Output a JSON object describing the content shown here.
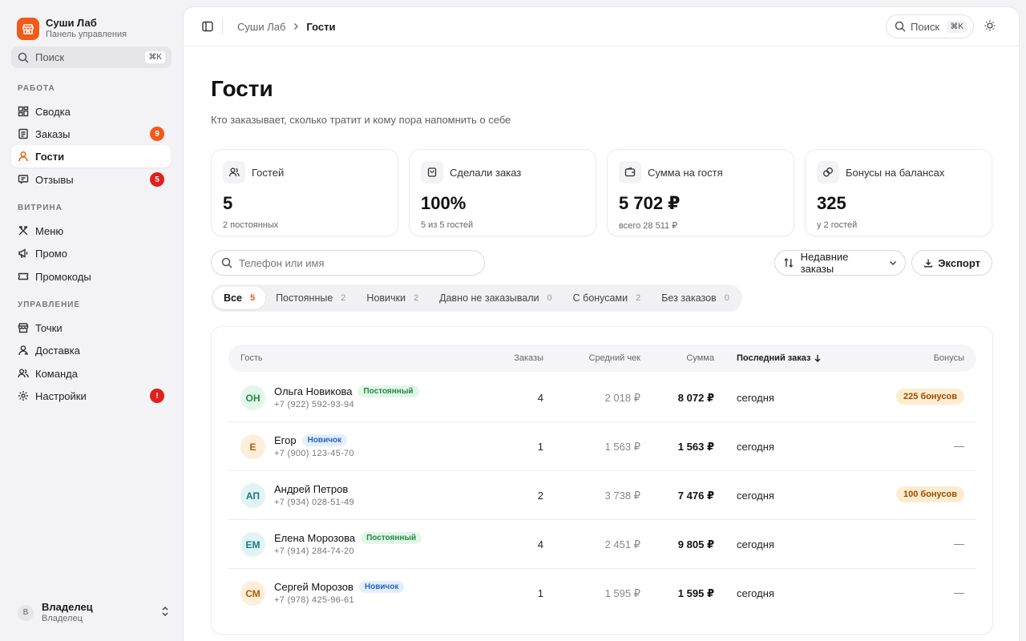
{
  "brand": {
    "title": "Суши Лаб",
    "subtitle": "Панель управления"
  },
  "sidebar_search": {
    "label": "Поиск",
    "shortcut": "⌘K"
  },
  "nav": {
    "sections": [
      {
        "title": "РАБОТА",
        "items": [
          {
            "label": "Сводка",
            "icon": "dashboard-icon"
          },
          {
            "label": "Заказы",
            "icon": "orders-icon",
            "badge": "9",
            "badge_color": "#f25a1a"
          },
          {
            "label": "Гости",
            "icon": "user-icon",
            "active": true
          },
          {
            "label": "Отзывы",
            "icon": "reviews-icon",
            "badge": "5",
            "badge_color": "#e0201a"
          }
        ]
      },
      {
        "title": "ВИТРИНА",
        "items": [
          {
            "label": "Меню",
            "icon": "utensils-icon"
          },
          {
            "label": "Промо",
            "icon": "megaphone-icon"
          },
          {
            "label": "Промокоды",
            "icon": "ticket-icon"
          }
        ]
      },
      {
        "title": "УПРАВЛЕНИЕ",
        "items": [
          {
            "label": "Точки",
            "icon": "store-icon"
          },
          {
            "label": "Доставка",
            "icon": "delivery-icon"
          },
          {
            "label": "Команда",
            "icon": "team-icon"
          },
          {
            "label": "Настройки",
            "icon": "gear-icon",
            "badge": "!",
            "badge_color": "#e0201a"
          }
        ]
      }
    ]
  },
  "user": {
    "initial": "В",
    "name": "Владелец",
    "role": "Владелец"
  },
  "breadcrumbs": {
    "root": "Суши Лаб",
    "current": "Гости"
  },
  "top_search": {
    "label": "Поиск",
    "shortcut": "⌘K"
  },
  "page": {
    "title": "Гости",
    "subtitle": "Кто заказывает, сколько тратит и кому пора напомнить о себе"
  },
  "stats": [
    {
      "label": "Гостей",
      "value": "5",
      "note": "2 постоянных",
      "icon": "users-icon"
    },
    {
      "label": "Сделали заказ",
      "value": "100%",
      "note": "5 из 5 гостей",
      "icon": "bag-icon"
    },
    {
      "label": "Сумма на гостя",
      "value": "5 702 ₽",
      "note": "всего 28 511 ₽",
      "icon": "wallet-icon"
    },
    {
      "label": "Бонусы на балансах",
      "value": "325",
      "note": "у 2 гостей",
      "icon": "coins-icon"
    }
  ],
  "guest_search": {
    "placeholder": "Телефон или имя",
    "value": ""
  },
  "sort": {
    "label": "Недавние заказы"
  },
  "export": {
    "label": "Экспорт"
  },
  "filters": [
    {
      "label": "Все",
      "count": "5",
      "active": true
    },
    {
      "label": "Постоянные",
      "count": "2"
    },
    {
      "label": "Новички",
      "count": "2"
    },
    {
      "label": "Давно не заказывали",
      "count": "0"
    },
    {
      "label": "С бонусами",
      "count": "2"
    },
    {
      "label": "Без заказов",
      "count": "0"
    }
  ],
  "table": {
    "columns": {
      "guest": "Гость",
      "orders": "Заказы",
      "avg": "Средний чек",
      "sum": "Сумма",
      "last": "Последний заказ",
      "bonus": "Бонусы"
    },
    "rows": [
      {
        "initials": "ОН",
        "name": "Ольга Новикова",
        "tag": "Постоянный",
        "phone": "+7 (922) 592-93-94",
        "orders": "4",
        "avg": "2 018 ₽",
        "sum": "8 072 ₽",
        "last": "сегодня",
        "bonus": "225 бонусов",
        "av_bg": "#e4f6ea",
        "av_fg": "#1f8a47"
      },
      {
        "initials": "Е",
        "name": "Егор",
        "tag": "Новичок",
        "phone": "+7 (900) 123-45-70",
        "orders": "1",
        "avg": "1 563 ₽",
        "sum": "1 563 ₽",
        "last": "сегодня",
        "bonus": "—",
        "av_bg": "#fdeedb",
        "av_fg": "#b35a00"
      },
      {
        "initials": "АП",
        "name": "Андрей Петров",
        "tag": "",
        "phone": "+7 (934) 028-51-49",
        "orders": "2",
        "avg": "3 738 ₽",
        "sum": "7 476 ₽",
        "last": "сегодня",
        "bonus": "100 бонусов",
        "av_bg": "#e2f3f4",
        "av_fg": "#1b7b83"
      },
      {
        "initials": "ЕМ",
        "name": "Елена Морозова",
        "tag": "Постоянный",
        "phone": "+7 (914) 284-74-20",
        "orders": "4",
        "avg": "2 451 ₽",
        "sum": "9 805 ₽",
        "last": "сегодня",
        "bonus": "—",
        "av_bg": "#e2f3f4",
        "av_fg": "#1b7b83"
      },
      {
        "initials": "СМ",
        "name": "Сергей Морозов",
        "tag": "Новичок",
        "phone": "+7 (978) 425-96-61",
        "orders": "1",
        "avg": "1 595 ₽",
        "sum": "1 595 ₽",
        "last": "сегодня",
        "bonus": "—",
        "av_bg": "#fdeedb",
        "av_fg": "#b35a00"
      }
    ]
  }
}
